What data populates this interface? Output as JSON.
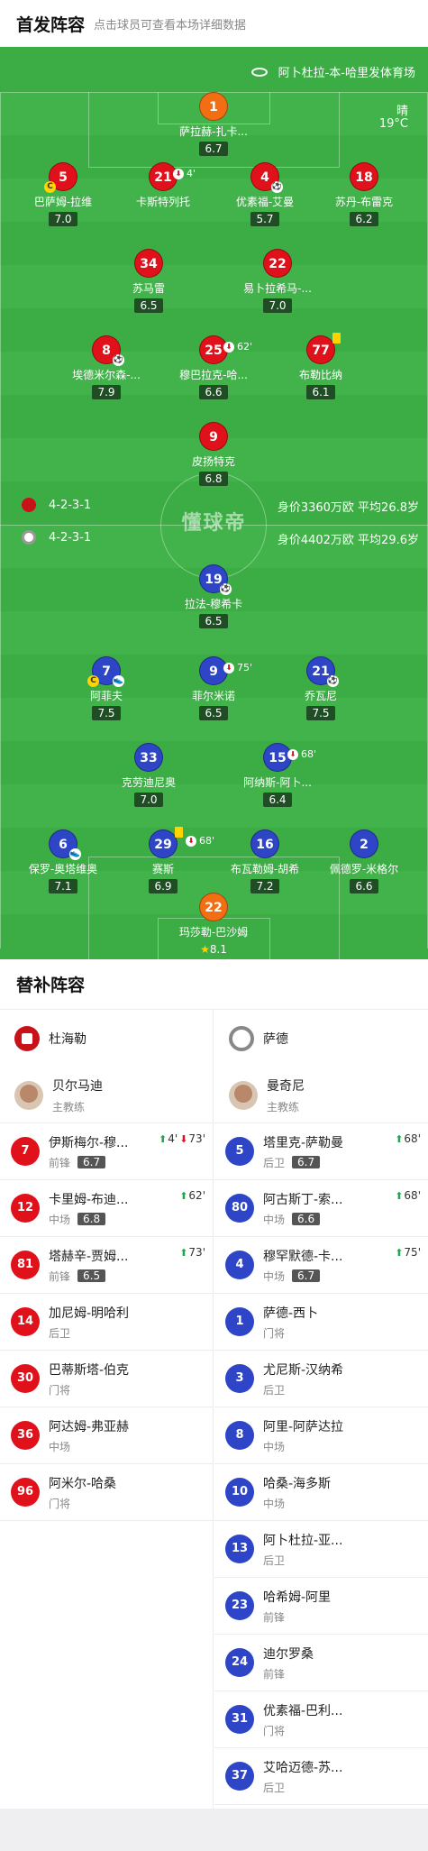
{
  "header": {
    "title": "首发阵容",
    "subtitle": "点击球员可查看本场详细数据"
  },
  "pitch": {
    "venue": "阿卜杜拉-本-哈里发体育场",
    "weather": "晴",
    "temperature": "19°C",
    "watermark": "懂球帝",
    "home": {
      "formation": "4-2-3-1",
      "value": "身价3360万欧 平均26.8岁"
    },
    "away": {
      "formation": "4-2-3-1",
      "value": "身价4402万欧 平均29.6岁"
    },
    "home_players": [
      {
        "num": "1",
        "name": "萨拉赫-扎卡...",
        "rating": "6.7"
      },
      {
        "num": "5",
        "name": "巴萨姆-拉维",
        "rating": "7.0"
      },
      {
        "num": "21",
        "name": "卡斯特列托",
        "rating": "",
        "sub_min": "4'"
      },
      {
        "num": "4",
        "name": "优素福-艾曼",
        "rating": "5.7"
      },
      {
        "num": "18",
        "name": "苏丹-布雷克",
        "rating": "6.2"
      },
      {
        "num": "34",
        "name": "苏马雷",
        "rating": "6.5"
      },
      {
        "num": "22",
        "name": "易卜拉希马-...",
        "rating": "7.0"
      },
      {
        "num": "8",
        "name": "埃德米尔森-...",
        "rating": "7.9"
      },
      {
        "num": "25",
        "name": "穆巴拉克-哈...",
        "rating": "6.6",
        "sub_min": "62'"
      },
      {
        "num": "77",
        "name": "布勒比纳",
        "rating": "6.1"
      },
      {
        "num": "9",
        "name": "皮扬特克",
        "rating": "6.8"
      }
    ],
    "away_players": [
      {
        "num": "19",
        "name": "拉法-穆希卡",
        "rating": "6.5"
      },
      {
        "num": "7",
        "name": "阿菲夫",
        "rating": "7.5"
      },
      {
        "num": "9",
        "name": "菲尔米诺",
        "rating": "6.5",
        "sub_min": "75'"
      },
      {
        "num": "21",
        "name": "乔瓦尼",
        "rating": "7.5"
      },
      {
        "num": "33",
        "name": "克劳迪尼奥",
        "rating": "7.0"
      },
      {
        "num": "15",
        "name": "阿纳斯-阿卜...",
        "rating": "6.4",
        "sub_min": "68'"
      },
      {
        "num": "6",
        "name": "保罗-奥塔维奥",
        "rating": "7.1"
      },
      {
        "num": "29",
        "name": "赛斯",
        "rating": "6.9",
        "sub_min": "68'"
      },
      {
        "num": "16",
        "name": "布瓦勒姆-胡希",
        "rating": "7.2"
      },
      {
        "num": "2",
        "name": "佩德罗-米格尔",
        "rating": "6.6"
      },
      {
        "num": "22",
        "name": "玛莎勒-巴沙姆",
        "rating": "8.1"
      }
    ]
  },
  "subs": {
    "title": "替补阵容",
    "home": {
      "team": "杜海勒",
      "coach": {
        "name": "贝尔马迪",
        "role": "主教练"
      },
      "players": [
        {
          "num": "7",
          "name": "伊斯梅尔-穆...",
          "pos": "前锋",
          "rating": "6.7",
          "goal_min": "4'",
          "sub_min": "73'"
        },
        {
          "num": "12",
          "name": "卡里姆-布迪...",
          "pos": "中场",
          "rating": "6.8",
          "goal_min": "62'"
        },
        {
          "num": "81",
          "name": "塔赫辛-贾姆...",
          "pos": "前锋",
          "rating": "6.5",
          "goal_min": "73'"
        },
        {
          "num": "14",
          "name": "加尼姆-明哈利",
          "pos": "后卫"
        },
        {
          "num": "30",
          "name": "巴蒂斯塔-伯克",
          "pos": "门将"
        },
        {
          "num": "36",
          "name": "阿达姆-弗亚赫",
          "pos": "中场"
        },
        {
          "num": "96",
          "name": "阿米尔-哈桑",
          "pos": "门将"
        }
      ]
    },
    "away": {
      "team": "萨德",
      "coach": {
        "name": "曼奇尼",
        "role": "主教练"
      },
      "players": [
        {
          "num": "5",
          "name": "塔里克-萨勒曼",
          "pos": "后卫",
          "rating": "6.7",
          "goal_min": "68'"
        },
        {
          "num": "80",
          "name": "阿古斯丁-索...",
          "pos": "中场",
          "rating": "6.6",
          "goal_min": "68'"
        },
        {
          "num": "4",
          "name": "穆罕默德-卡...",
          "pos": "中场",
          "rating": "6.7",
          "goal_min": "75'"
        },
        {
          "num": "1",
          "name": "萨德-西卜",
          "pos": "门将"
        },
        {
          "num": "3",
          "name": "尤尼斯-汉纳希",
          "pos": "后卫"
        },
        {
          "num": "8",
          "name": "阿里-阿萨达拉",
          "pos": "中场"
        },
        {
          "num": "10",
          "name": "哈桑-海多斯",
          "pos": "中场"
        },
        {
          "num": "13",
          "name": "阿卜杜拉-亚...",
          "pos": "后卫"
        },
        {
          "num": "23",
          "name": "哈希姆-阿里",
          "pos": "前锋"
        },
        {
          "num": "24",
          "name": "迪尔罗桑",
          "pos": "前锋"
        },
        {
          "num": "31",
          "name": "优素福-巴利...",
          "pos": "门将"
        },
        {
          "num": "37",
          "name": "艾哈迈德-苏...",
          "pos": "后卫"
        }
      ]
    }
  },
  "colors": {
    "home": "#e0111b",
    "away": "#2d45c6",
    "gk": "#f36d13",
    "pitch": "#3cad45"
  }
}
